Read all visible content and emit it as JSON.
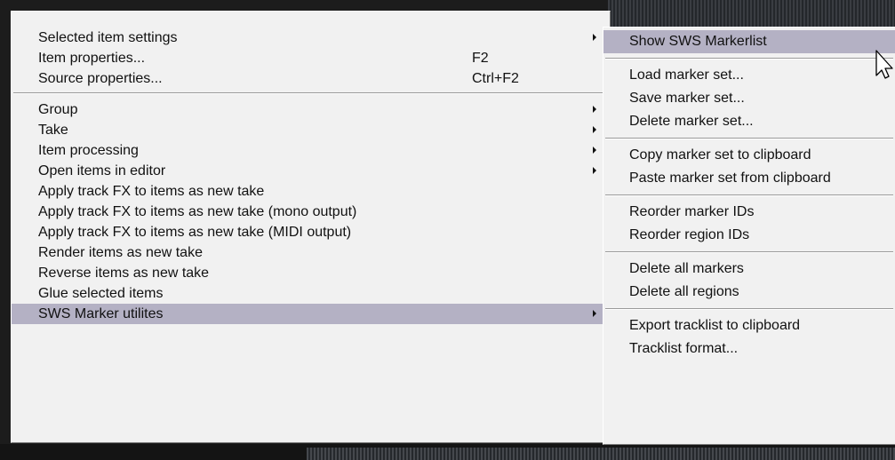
{
  "main_menu": {
    "items": [
      {
        "label": "Selected item settings",
        "submenu": true
      },
      {
        "label": "Item properties...",
        "shortcut": "F2"
      },
      {
        "label": "Source properties...",
        "shortcut": "Ctrl+F2"
      },
      {
        "separator": true
      },
      {
        "label": "Group",
        "submenu": true
      },
      {
        "label": "Take",
        "submenu": true
      },
      {
        "label": "Item processing",
        "submenu": true
      },
      {
        "label": "Open items in editor",
        "submenu": true
      },
      {
        "label": "Apply track FX to items as new take"
      },
      {
        "label": "Apply track FX to items as new take (mono output)"
      },
      {
        "label": "Apply track FX to items as new take (MIDI output)"
      },
      {
        "label": "Render items as new take"
      },
      {
        "label": "Reverse items as new take"
      },
      {
        "label": "Glue selected items"
      },
      {
        "label": "SWS Marker utilites",
        "submenu": true,
        "highlighted": true
      }
    ]
  },
  "sub_menu": {
    "items": [
      {
        "label": "Show SWS Markerlist",
        "highlighted": true
      },
      {
        "separator": true
      },
      {
        "label": "Load marker set..."
      },
      {
        "label": "Save marker set..."
      },
      {
        "label": "Delete marker set..."
      },
      {
        "separator": true
      },
      {
        "label": "Copy marker set to clipboard"
      },
      {
        "label": "Paste marker set from clipboard"
      },
      {
        "separator": true
      },
      {
        "label": "Reorder marker IDs"
      },
      {
        "label": "Reorder region IDs"
      },
      {
        "separator": true
      },
      {
        "label": "Delete all markers"
      },
      {
        "label": "Delete all regions"
      },
      {
        "separator": true
      },
      {
        "label": "Export tracklist to clipboard"
      },
      {
        "label": "Tracklist format..."
      }
    ]
  },
  "colors": {
    "menu_bg": "#f1f1f1",
    "highlight": "#b4b1c4",
    "text": "#111111"
  },
  "cursor_icon": "arrow-pointer-icon"
}
